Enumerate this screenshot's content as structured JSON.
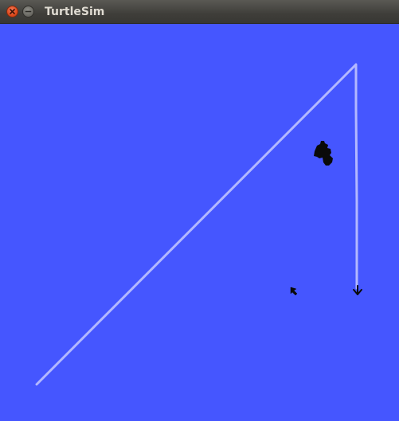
{
  "window": {
    "title": "TurtleSim"
  },
  "icons": {
    "close": "close-icon",
    "minimize": "minimize-icon",
    "turtle": "turtle-icon",
    "cursor": "mouse-pointer-icon",
    "heading": "turtle-heading-arrow-icon"
  },
  "colors": {
    "background": "#4556ff",
    "pen": "#b3b8ff",
    "titlebar": "#3f3e3a",
    "close_button": "#df4a1c"
  }
}
